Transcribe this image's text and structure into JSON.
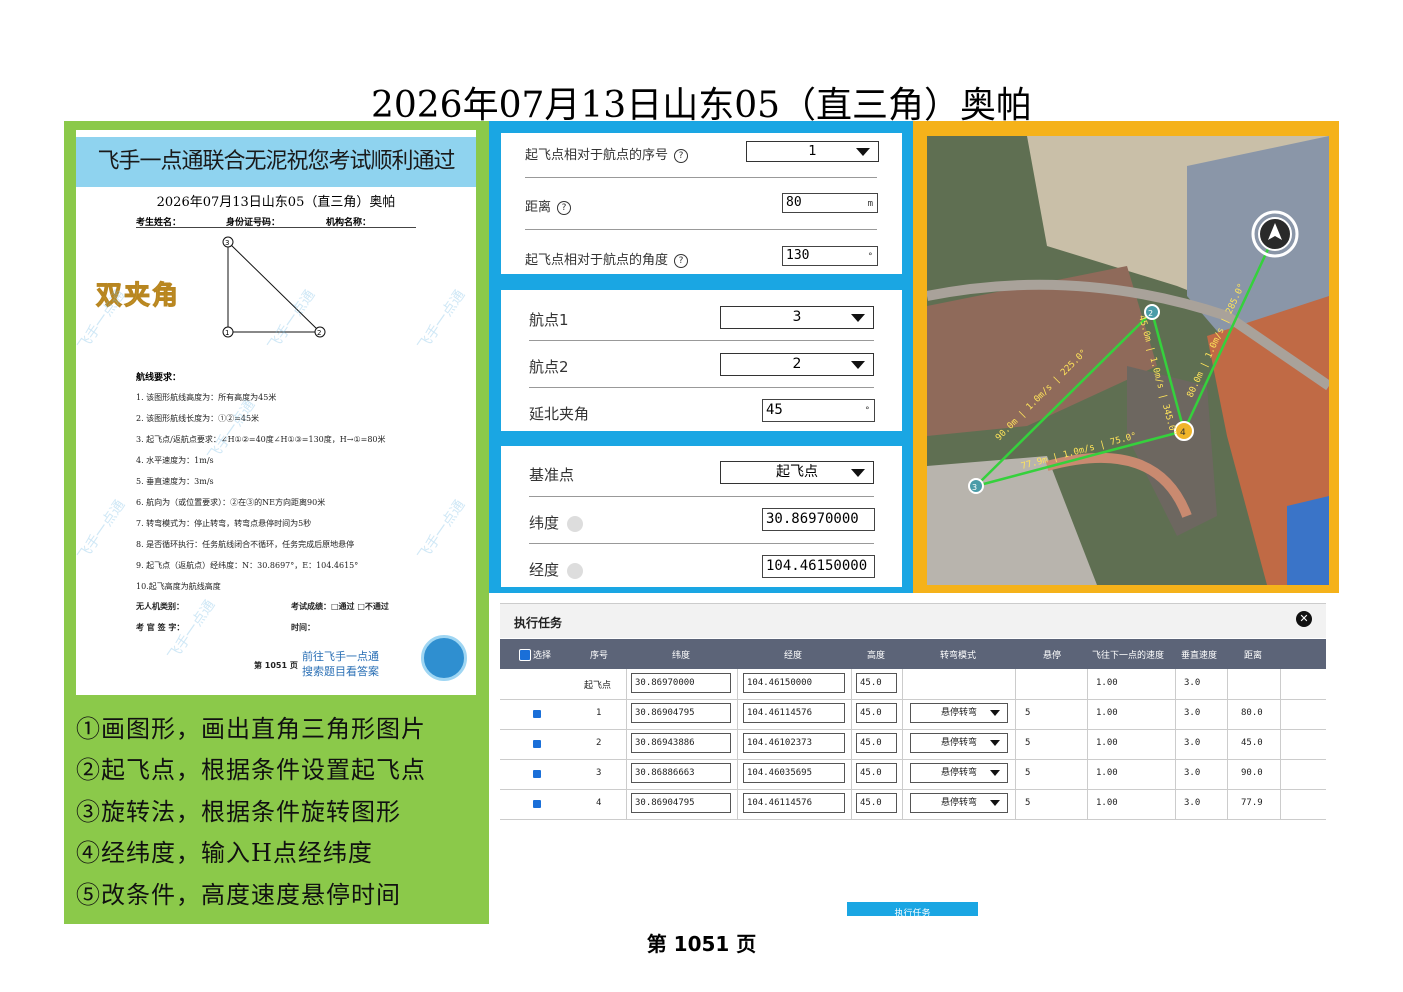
{
  "header": {
    "title": "2026年07月13日山东05（直三角）奥帕"
  },
  "paper": {
    "banner": "飞手一点通联合无泥祝您考试顺利通过",
    "title": "2026年07月13日山东05（直三角）奥帕",
    "fields": [
      "考生姓名：",
      "身份证号码：",
      "机构名称："
    ],
    "sticker": "双夹角",
    "points": [
      "①",
      "②",
      "③"
    ],
    "req_head": "航线要求：",
    "requirements": [
      "1. 该图形航线高度为：所有高度为45米",
      "2. 该图形航线长度为：①②=45米",
      "3. 起飞点/返航点要求：∠H①②=40度∠H①③=130度，H→①=80米",
      "4. 水平速度为：1m/s",
      "5. 垂直速度为：3m/s",
      "6. 航向为（或位置要求）：②在③的NE方向距离90米",
      "7. 转弯模式为：停止转弯，转弯点悬停时间为5秒",
      "8. 是否循环执行：任务航线闭合不循环，任务完成后原地悬停",
      "9. 起飞点（返航点）经纬度：N：30.8697°，E：104.4615°",
      "10.起飞高度为航线高度"
    ],
    "exam_rows": [
      "无人机类别：",
      "考试成绩：□通过  □不通过",
      "考 官 签 字：",
      "时间："
    ],
    "page": "第 1051 页",
    "promo1": "前往飞手一点通",
    "promo2": "搜索题目看答案",
    "watermark": "飞手一点通"
  },
  "steps": [
    "①画图形，画出直角三角形图片",
    "②起飞点，根据条件设置起飞点",
    "③旋转法，根据条件旋转图形",
    "④经纬度，输入H点经纬度",
    "⑤改条件，高度速度悬停时间"
  ],
  "form1": {
    "seq_label": "起飞点相对于航点的序号",
    "seq_value": "1",
    "dist_label": "距离",
    "dist_value": "80",
    "dist_unit": "m",
    "angle_label": "起飞点相对于航点的角度",
    "angle_value": "130",
    "angle_unit": "°",
    "help": "?"
  },
  "form2": {
    "wp1_label": "航点1",
    "wp1_value": "3",
    "wp2_label": "航点2",
    "wp2_value": "2",
    "north_label": "延北夹角",
    "north_value": "45",
    "north_unit": "°"
  },
  "form3": {
    "base_label": "基准点",
    "base_value": "起飞点",
    "lat_label": "纬度",
    "lat_value": "30.86970000",
    "lon_label": "经度",
    "lon_value": "104.46150000"
  },
  "map": {
    "labels": {
      "home": "H",
      "p1": "1",
      "p2": "2",
      "p3": "3",
      "p4": "4"
    },
    "segments": [
      "80.0m | 1.0m/s | 285.0°",
      "45.0m | 1.0m/s | 345.0°",
      "90.0m | 1.0m/s | 225.0°",
      "77.9m | 1.0m/s | 75.0°"
    ]
  },
  "task": {
    "title": "执行任务",
    "close": "✕",
    "columns": [
      "选择",
      "序号",
      "纬度",
      "经度",
      "高度",
      "转弯模式",
      "悬停",
      "飞往下一点的速度",
      "垂直速度",
      "距离"
    ],
    "rows": [
      {
        "seq": "起飞点",
        "lat": "30.86970000",
        "lon": "104.46150000",
        "alt": "45.0",
        "turn": "",
        "hover": "",
        "speed": "1.00",
        "vspeed": "3.0",
        "dist": ""
      },
      {
        "seq": "1",
        "lat": "30.86904795",
        "lon": "104.46114576",
        "alt": "45.0",
        "turn": "悬停转弯",
        "hover": "5",
        "speed": "1.00",
        "vspeed": "3.0",
        "dist": "80.0"
      },
      {
        "seq": "2",
        "lat": "30.86943886",
        "lon": "104.46102373",
        "alt": "45.0",
        "turn": "悬停转弯",
        "hover": "5",
        "speed": "1.00",
        "vspeed": "3.0",
        "dist": "45.0"
      },
      {
        "seq": "3",
        "lat": "30.86886663",
        "lon": "104.46035695",
        "alt": "45.0",
        "turn": "悬停转弯",
        "hover": "5",
        "speed": "1.00",
        "vspeed": "3.0",
        "dist": "90.0"
      },
      {
        "seq": "4",
        "lat": "30.86904795",
        "lon": "104.46114576",
        "alt": "45.0",
        "turn": "悬停转弯",
        "hover": "5",
        "speed": "1.00",
        "vspeed": "3.0",
        "dist": "77.9"
      }
    ],
    "exec_button": "执行任务"
  },
  "footer": {
    "page": "第 1051 页"
  }
}
